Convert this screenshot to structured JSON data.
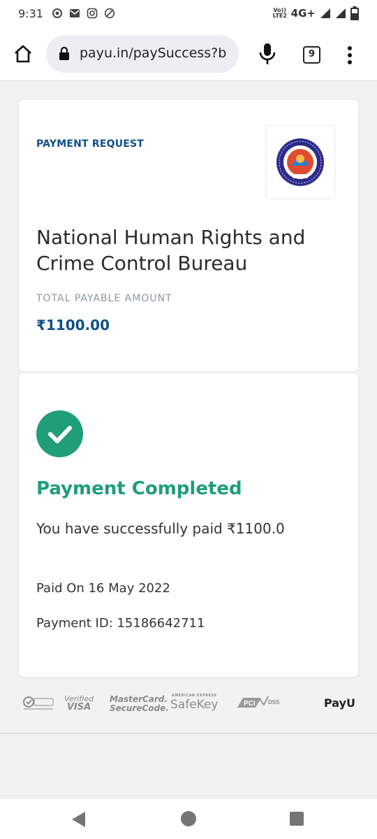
{
  "status_bar": {
    "time": "9:31",
    "volte": "Vo)) LTE2",
    "network": "4G+",
    "icons": [
      "sync-icon",
      "gmail-icon",
      "instagram-icon",
      "data-saver-icon",
      "signal-icon",
      "signal-icon",
      "battery-icon"
    ]
  },
  "browser": {
    "url": "payu.in/paySuccess?b",
    "tab_count": "9",
    "icons": [
      "home-icon",
      "lock-icon",
      "mic-icon",
      "more-vert-icon"
    ]
  },
  "payment_request": {
    "label": "PAYMENT REQUEST",
    "merchant_name": "National Human Rights and Crime Control Bureau",
    "logo_icon": "merchant-seal-logo",
    "total_label": "TOTAL PAYABLE AMOUNT",
    "amount": "₹1100.00"
  },
  "status": {
    "icon": "check-circle-icon",
    "title": "Payment Completed",
    "message": "You have successfully paid ₹1100.0",
    "paid_on": "Paid On 16 May 2022",
    "payment_id": "Payment ID: 15186642711"
  },
  "trust_badges": {
    "visa_line1": "Verified",
    "visa_line2": "VISA",
    "mc_line1": "MasterCard.",
    "mc_line2": "SecureCode.",
    "amex_small": "AMERICAN EXPRESS",
    "safekey": "SafeKey",
    "pci": "DSS",
    "payu": "PayU"
  },
  "colors": {
    "primary_blue": "#0f4f8b",
    "success_green": "#1f9e79",
    "label_gray": "#8a96a3"
  }
}
